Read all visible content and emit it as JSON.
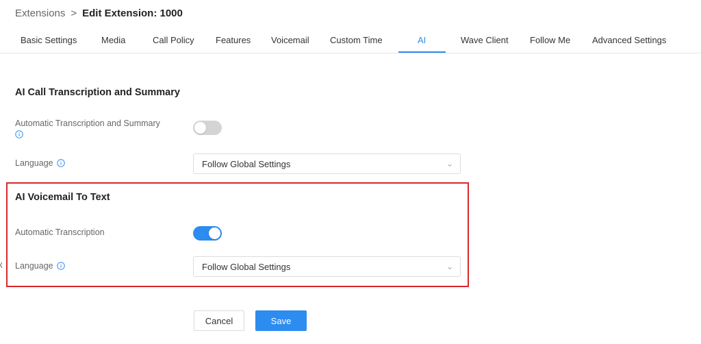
{
  "breadcrumb": {
    "parent": "Extensions",
    "separator": ">",
    "current": "Edit Extension: 1000"
  },
  "tabs": [
    {
      "label": "Basic Settings",
      "active": false
    },
    {
      "label": "Media",
      "active": false
    },
    {
      "label": "Call Policy",
      "active": false
    },
    {
      "label": "Features",
      "active": false
    },
    {
      "label": "Voicemail",
      "active": false
    },
    {
      "label": "Custom Time",
      "active": false
    },
    {
      "label": "AI",
      "active": true
    },
    {
      "label": "Wave Client",
      "active": false
    },
    {
      "label": "Follow Me",
      "active": false
    },
    {
      "label": "Advanced Settings",
      "active": false
    }
  ],
  "ai_call": {
    "title": "AI Call Transcription and Summary",
    "auto_label": "Automatic Transcription and Summary",
    "auto_enabled": false,
    "language_label": "Language",
    "language_value": "Follow Global Settings"
  },
  "ai_voicemail": {
    "title": "AI Voicemail To Text",
    "auto_label": "Automatic Transcription",
    "auto_enabled": true,
    "language_label": "Language",
    "language_value": "Follow Global Settings"
  },
  "actions": {
    "cancel_label": "Cancel",
    "save_label": "Save"
  },
  "colors": {
    "accent": "#2d8cf0",
    "highlight_border": "#d9262b",
    "toggle_off": "#d4d4d4"
  },
  "icons": {
    "info": "info-icon",
    "chevron": "chevron-down-icon"
  }
}
